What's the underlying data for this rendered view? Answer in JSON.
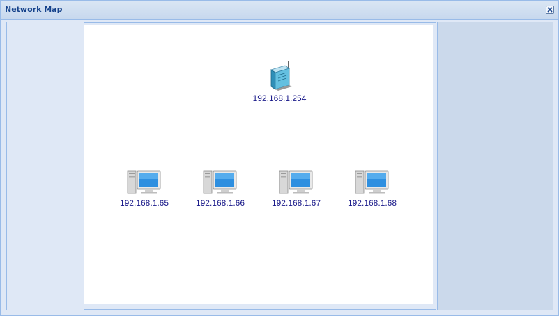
{
  "window": {
    "title": "Network Map"
  },
  "map": {
    "router": {
      "ip": "192.168.1.254",
      "icon": "router-icon"
    },
    "clients": [
      {
        "ip": "192.168.1.65",
        "icon": "computer-icon"
      },
      {
        "ip": "192.168.1.66",
        "icon": "computer-icon"
      },
      {
        "ip": "192.168.1.67",
        "icon": "computer-icon"
      },
      {
        "ip": "192.168.1.68",
        "icon": "computer-icon"
      }
    ]
  },
  "colors": {
    "title_text": "#15428b",
    "label_text": "#1a1a8a",
    "panel_bg": "#dfe8f6",
    "border": "#99bbe8"
  }
}
